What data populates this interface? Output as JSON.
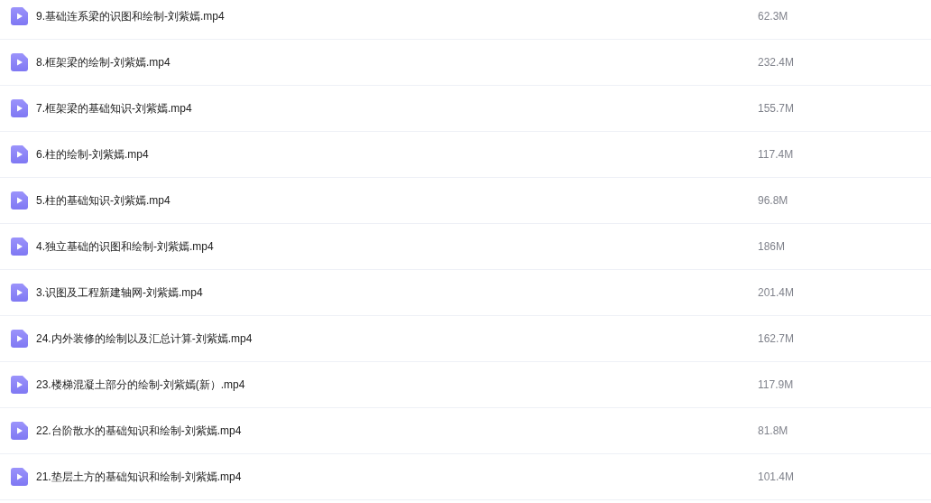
{
  "files": [
    {
      "name": "9.基础连系梁的识图和绘制-刘紫嫣.mp4",
      "size": "62.3M"
    },
    {
      "name": "8.框架梁的绘制-刘紫嫣.mp4",
      "size": "232.4M"
    },
    {
      "name": "7.框架梁的基础知识-刘紫嫣.mp4",
      "size": "155.7M"
    },
    {
      "name": "6.柱的绘制-刘紫嫣.mp4",
      "size": "117.4M"
    },
    {
      "name": "5.柱的基础知识-刘紫嫣.mp4",
      "size": "96.8M"
    },
    {
      "name": "4.独立基础的识图和绘制-刘紫嫣.mp4",
      "size": "186M"
    },
    {
      "name": "3.识图及工程新建轴网-刘紫嫣.mp4",
      "size": "201.4M"
    },
    {
      "name": "24.内外装修的绘制以及汇总计算-刘紫嫣.mp4",
      "size": "162.7M"
    },
    {
      "name": "23.楼梯混凝土部分的绘制-刘紫嫣(新）.mp4",
      "size": "117.9M"
    },
    {
      "name": "22.台阶散水的基础知识和绘制-刘紫嫣.mp4",
      "size": "81.8M"
    },
    {
      "name": "21.垫层土方的基础知识和绘制-刘紫嫣.mp4",
      "size": "101.4M"
    }
  ]
}
